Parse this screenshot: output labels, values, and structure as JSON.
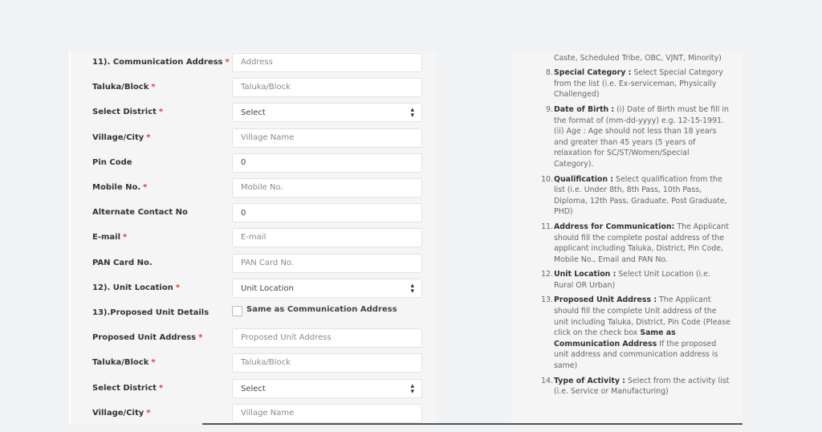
{
  "form": {
    "rows": [
      {
        "label": "11). Communication Address",
        "required": true,
        "type": "input",
        "value": "",
        "placeholder": "Address"
      },
      {
        "label": "Taluka/Block",
        "required": true,
        "type": "input",
        "value": "",
        "placeholder": "Taluka/Block"
      },
      {
        "label": "Select District",
        "required": true,
        "type": "select",
        "value": "Select",
        "placeholder": ""
      },
      {
        "label": "Village/City",
        "required": true,
        "type": "input",
        "value": "",
        "placeholder": "Village Name"
      },
      {
        "label": "Pin Code",
        "required": false,
        "type": "input",
        "value": "0",
        "placeholder": ""
      },
      {
        "label": "Mobile No.",
        "required": true,
        "type": "input",
        "value": "",
        "placeholder": "Mobile No."
      },
      {
        "label": "Alternate Contact No",
        "required": false,
        "type": "input",
        "value": "0",
        "placeholder": ""
      },
      {
        "label": "E-mail",
        "required": true,
        "type": "input",
        "value": "",
        "placeholder": "E-mail"
      },
      {
        "label": "PAN Card No.",
        "required": false,
        "type": "input",
        "value": "",
        "placeholder": "PAN Card No."
      },
      {
        "label": "12). Unit Location",
        "required": true,
        "type": "select",
        "value": "Unit Location",
        "placeholder": ""
      },
      {
        "label": "13).Proposed Unit Details",
        "required": false,
        "type": "checkbox",
        "value": "Same as Communication Address",
        "checked": false
      },
      {
        "label": "Proposed Unit Address",
        "required": true,
        "type": "input",
        "value": "",
        "placeholder": "Proposed Unit Address"
      },
      {
        "label": "Taluka/Block",
        "required": true,
        "type": "input",
        "value": "",
        "placeholder": "Taluka/Block"
      },
      {
        "label": "Select District",
        "required": true,
        "type": "select",
        "value": "Select",
        "placeholder": ""
      },
      {
        "label": "Village/City",
        "required": true,
        "type": "input",
        "value": "",
        "placeholder": "Village Name"
      }
    ],
    "required_mark": "*",
    "select_arrow": "⬍"
  },
  "instructions": {
    "items": [
      {
        "num": "",
        "title": "",
        "text": "applicant from the list (i.e. General, Scheduled Caste, Scheduled Tribe, OBC, VJNT, Minority)"
      },
      {
        "num": "8.",
        "title": "Special Category :",
        "text": " Select Special Category from the list (i.e. Ex-serviceman, Physically Challenged)"
      },
      {
        "num": "9.",
        "title": "Date of Birth :",
        "text": " (i) Date of Birth must be fill in the format of (mm-dd-yyyy) e.g. 12-15-1991. (ii) Age : Age should not less than 18 years and greater than 45 years (5 years of relaxation for SC/ST/Women/Special Category)."
      },
      {
        "num": "10.",
        "title": "Qualification :",
        "text": " Select qualification from the list (i.e. Under 8th, 8th Pass, 10th Pass, Diploma, 12th Pass, Graduate, Post Graduate, PHD)"
      },
      {
        "num": "11.",
        "title": "Address for Communication:",
        "text": " The Applicant should fill the complete postal address of the applicant including Taluka, District, Pin Code, Mobile No., Email and PAN No."
      },
      {
        "num": "12.",
        "title": "Unit Location :",
        "text": " Select Unit Location (i.e. Rural OR Urban)"
      },
      {
        "num": "13.",
        "title": "Proposed Unit Address :",
        "text": " The Applicant should fill the complete Unit address of the unit including Taluka, District, Pin Code (Please click on the check box ",
        "bold2": "Same as Communication Address",
        "text2": " If the proposed unit address and communication address is same)"
      },
      {
        "num": "14.",
        "title": "Type of Activity :",
        "text": " Select from the activity list (i.e. Service or Manufacturing)"
      }
    ]
  },
  "colors": {
    "required": "#e53935",
    "panel": "#f5f5f5",
    "background": "#f1f2f4"
  }
}
